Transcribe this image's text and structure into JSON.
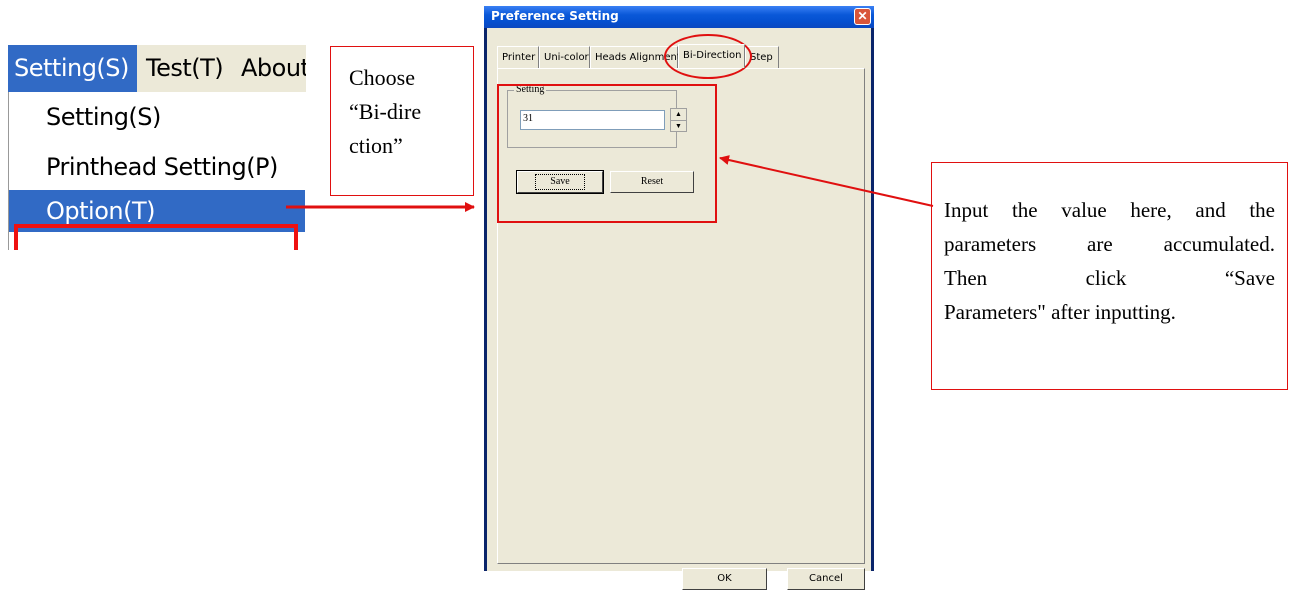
{
  "menu": {
    "menubar": [
      "Setting(S)",
      "Test(T)",
      "About"
    ],
    "items": [
      "Setting(S)",
      "Printhead Setting(P)",
      "Option(T)"
    ]
  },
  "callouts": {
    "choose": [
      "Choose",
      "“Bi-dire",
      "ction”"
    ],
    "input": [
      "Input the value here, and the",
      "parameters are accumulated.",
      "Then click “Save",
      "Parameters\" after inputting."
    ]
  },
  "dialog": {
    "title": "Preference Setting",
    "close_icon": "close-icon",
    "tabs": [
      "Printer",
      "Uni-color",
      "Heads Alignment",
      "Bi-Direction",
      "Step"
    ],
    "active_tab": "Bi-Direction",
    "group_label": "Setting",
    "value": "31",
    "save_label": "Save",
    "reset_label": "Reset",
    "ok_label": "OK",
    "cancel_label": "Cancel"
  },
  "colors": {
    "annotation": "#e01010",
    "menu_highlight": "#316ac5",
    "window_face": "#ece9d8",
    "titlebar": "#0a58d8"
  }
}
